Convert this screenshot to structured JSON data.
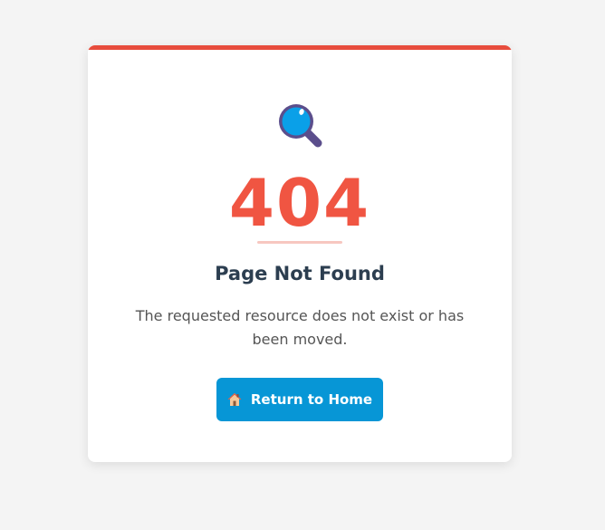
{
  "error": {
    "code": "404",
    "title": "Page Not Found",
    "message": "The requested resource does not exist or has been moved."
  },
  "actions": {
    "home_button_label": "Return to Home",
    "home_icon": "house-icon"
  },
  "icons": {
    "hero_icon": "magnifying-glass-icon"
  },
  "colors": {
    "accent": "#e74c3c",
    "code_color": "#f05542",
    "button_bg": "#0796d6",
    "title_color": "#2c3e50",
    "text_color": "#555555",
    "page_bg": "#f4f4f4"
  }
}
